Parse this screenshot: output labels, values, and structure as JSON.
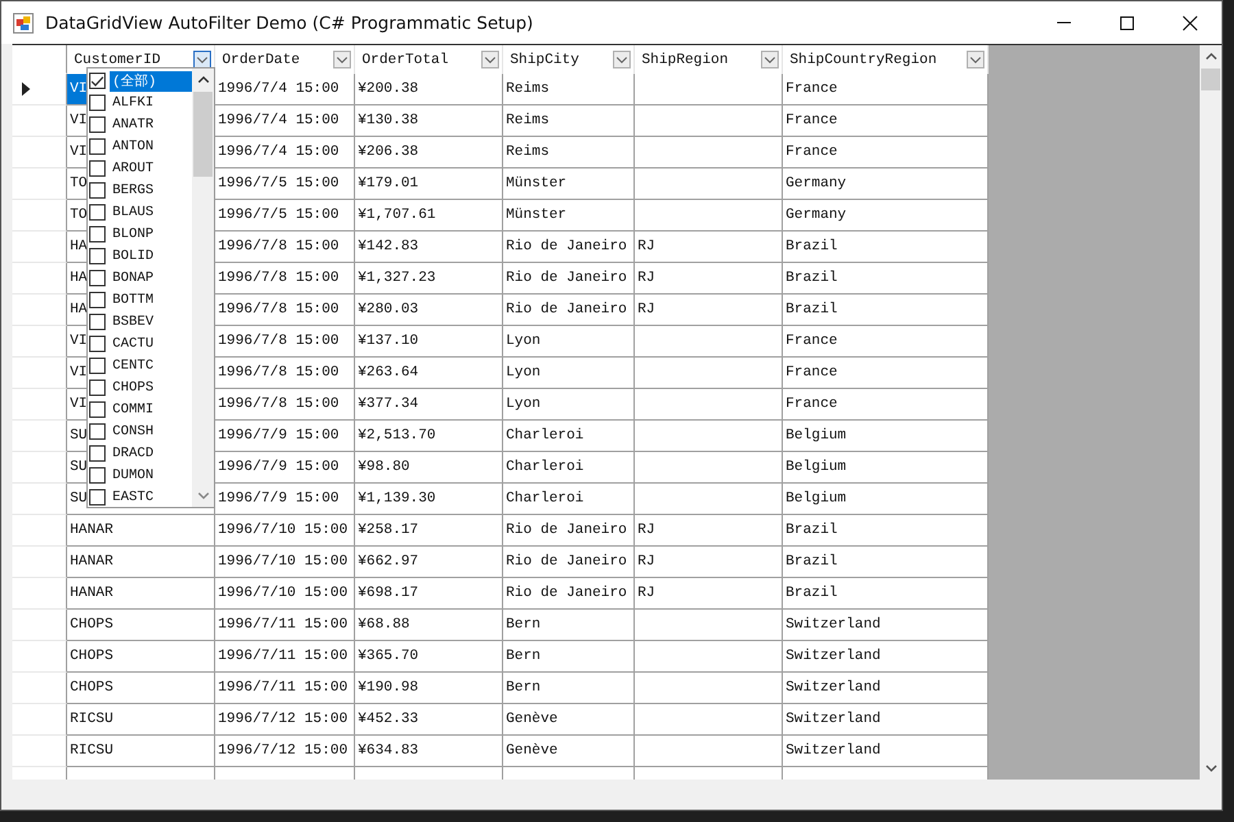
{
  "window": {
    "title": "DataGridView AutoFilter Demo (C# Programmatic Setup)"
  },
  "columns": [
    {
      "label": "CustomerID",
      "filter_open": true
    },
    {
      "label": "OrderDate",
      "filter_open": false
    },
    {
      "label": "OrderTotal",
      "filter_open": false
    },
    {
      "label": "ShipCity",
      "filter_open": false
    },
    {
      "label": "ShipRegion",
      "filter_open": false
    },
    {
      "label": "ShipCountryRegion",
      "filter_open": false
    }
  ],
  "rows": [
    {
      "selected": true,
      "customer_id": "VI",
      "order_date": "1996/7/4 15:00",
      "order_total": "¥200.38",
      "ship_city": "Reims",
      "ship_country_region": "France"
    },
    {
      "selected": false,
      "customer_id": "VI",
      "order_date": "1996/7/4 15:00",
      "order_total": "¥130.38",
      "ship_city": "Reims",
      "ship_country_region": "France"
    },
    {
      "selected": false,
      "customer_id": "VI",
      "order_date": "1996/7/4 15:00",
      "order_total": "¥206.38",
      "ship_city": "Reims",
      "ship_country_region": "France"
    },
    {
      "selected": false,
      "customer_id": "TO",
      "order_date": "1996/7/5 15:00",
      "order_total": "¥179.01",
      "ship_city": "Münster",
      "ship_country_region": "Germany"
    },
    {
      "selected": false,
      "customer_id": "TO",
      "order_date": "1996/7/5 15:00",
      "order_total": "¥1,707.61",
      "ship_city": "Münster",
      "ship_country_region": "Germany"
    },
    {
      "selected": false,
      "customer_id": "HA",
      "order_date": "1996/7/8 15:00",
      "order_total": "¥142.83",
      "ship_city": "Rio de Janeiro",
      "ship_region": "RJ",
      "ship_country_region": "Brazil"
    },
    {
      "selected": false,
      "customer_id": "HA",
      "order_date": "1996/7/8 15:00",
      "order_total": "¥1,327.23",
      "ship_city": "Rio de Janeiro",
      "ship_region": "RJ",
      "ship_country_region": "Brazil"
    },
    {
      "selected": false,
      "customer_id": "HA",
      "order_date": "1996/7/8 15:00",
      "order_total": "¥280.03",
      "ship_city": "Rio de Janeiro",
      "ship_region": "RJ",
      "ship_country_region": "Brazil"
    },
    {
      "selected": false,
      "customer_id": "VI",
      "order_date": "1996/7/8 15:00",
      "order_total": "¥137.10",
      "ship_city": "Lyon",
      "ship_country_region": "France"
    },
    {
      "selected": false,
      "customer_id": "VI",
      "order_date": "1996/7/8 15:00",
      "order_total": "¥263.64",
      "ship_city": "Lyon",
      "ship_country_region": "France"
    },
    {
      "selected": false,
      "customer_id": "VI",
      "order_date": "1996/7/8 15:00",
      "order_total": "¥377.34",
      "ship_city": "Lyon",
      "ship_country_region": "France"
    },
    {
      "selected": false,
      "customer_id": "SU",
      "order_date": "1996/7/9 15:00",
      "order_total": "¥2,513.70",
      "ship_city": "Charleroi",
      "ship_country_region": "Belgium"
    },
    {
      "selected": false,
      "customer_id": "SU",
      "order_date": "1996/7/9 15:00",
      "order_total": "¥98.80",
      "ship_city": "Charleroi",
      "ship_country_region": "Belgium"
    },
    {
      "selected": false,
      "customer_id": "SU",
      "order_date": "1996/7/9 15:00",
      "order_total": "¥1,139.30",
      "ship_city": "Charleroi",
      "ship_country_region": "Belgium"
    },
    {
      "selected": false,
      "customer_id": "HANAR",
      "order_date": "1996/7/10 15:00",
      "order_total": "¥258.17",
      "ship_city": "Rio de Janeiro",
      "ship_region": "RJ",
      "ship_country_region": "Brazil"
    },
    {
      "selected": false,
      "customer_id": "HANAR",
      "order_date": "1996/7/10 15:00",
      "order_total": "¥662.97",
      "ship_city": "Rio de Janeiro",
      "ship_region": "RJ",
      "ship_country_region": "Brazil"
    },
    {
      "selected": false,
      "customer_id": "HANAR",
      "order_date": "1996/7/10 15:00",
      "order_total": "¥698.17",
      "ship_city": "Rio de Janeiro",
      "ship_region": "RJ",
      "ship_country_region": "Brazil"
    },
    {
      "selected": false,
      "customer_id": "CHOPS",
      "order_date": "1996/7/11 15:00",
      "order_total": "¥68.88",
      "ship_city": "Bern",
      "ship_country_region": "Switzerland"
    },
    {
      "selected": false,
      "customer_id": "CHOPS",
      "order_date": "1996/7/11 15:00",
      "order_total": "¥365.70",
      "ship_city": "Bern",
      "ship_country_region": "Switzerland"
    },
    {
      "selected": false,
      "customer_id": "CHOPS",
      "order_date": "1996/7/11 15:00",
      "order_total": "¥190.98",
      "ship_city": "Bern",
      "ship_country_region": "Switzerland"
    },
    {
      "selected": false,
      "customer_id": "RICSU",
      "order_date": "1996/7/12 15:00",
      "order_total": "¥452.33",
      "ship_city": "Genève",
      "ship_country_region": "Switzerland"
    },
    {
      "selected": false,
      "customer_id": "RICSU",
      "order_date": "1996/7/12 15:00",
      "order_total": "¥634.83",
      "ship_city": "Genève",
      "ship_country_region": "Switzerland"
    }
  ],
  "filter_list": {
    "items": [
      {
        "label": "(全部)",
        "checked": true,
        "selected": true
      },
      {
        "label": "ALFKI",
        "checked": false,
        "selected": false
      },
      {
        "label": "ANATR",
        "checked": false,
        "selected": false
      },
      {
        "label": "ANTON",
        "checked": false,
        "selected": false
      },
      {
        "label": "AROUT",
        "checked": false,
        "selected": false
      },
      {
        "label": "BERGS",
        "checked": false,
        "selected": false
      },
      {
        "label": "BLAUS",
        "checked": false,
        "selected": false
      },
      {
        "label": "BLONP",
        "checked": false,
        "selected": false
      },
      {
        "label": "BOLID",
        "checked": false,
        "selected": false
      },
      {
        "label": "BONAP",
        "checked": false,
        "selected": false
      },
      {
        "label": "BOTTM",
        "checked": false,
        "selected": false
      },
      {
        "label": "BSBEV",
        "checked": false,
        "selected": false
      },
      {
        "label": "CACTU",
        "checked": false,
        "selected": false
      },
      {
        "label": "CENTC",
        "checked": false,
        "selected": false
      },
      {
        "label": "CHOPS",
        "checked": false,
        "selected": false
      },
      {
        "label": "COMMI",
        "checked": false,
        "selected": false
      },
      {
        "label": "CONSH",
        "checked": false,
        "selected": false
      },
      {
        "label": "DRACD",
        "checked": false,
        "selected": false
      },
      {
        "label": "DUMON",
        "checked": false,
        "selected": false
      },
      {
        "label": "EASTC",
        "checked": false,
        "selected": false
      }
    ]
  }
}
